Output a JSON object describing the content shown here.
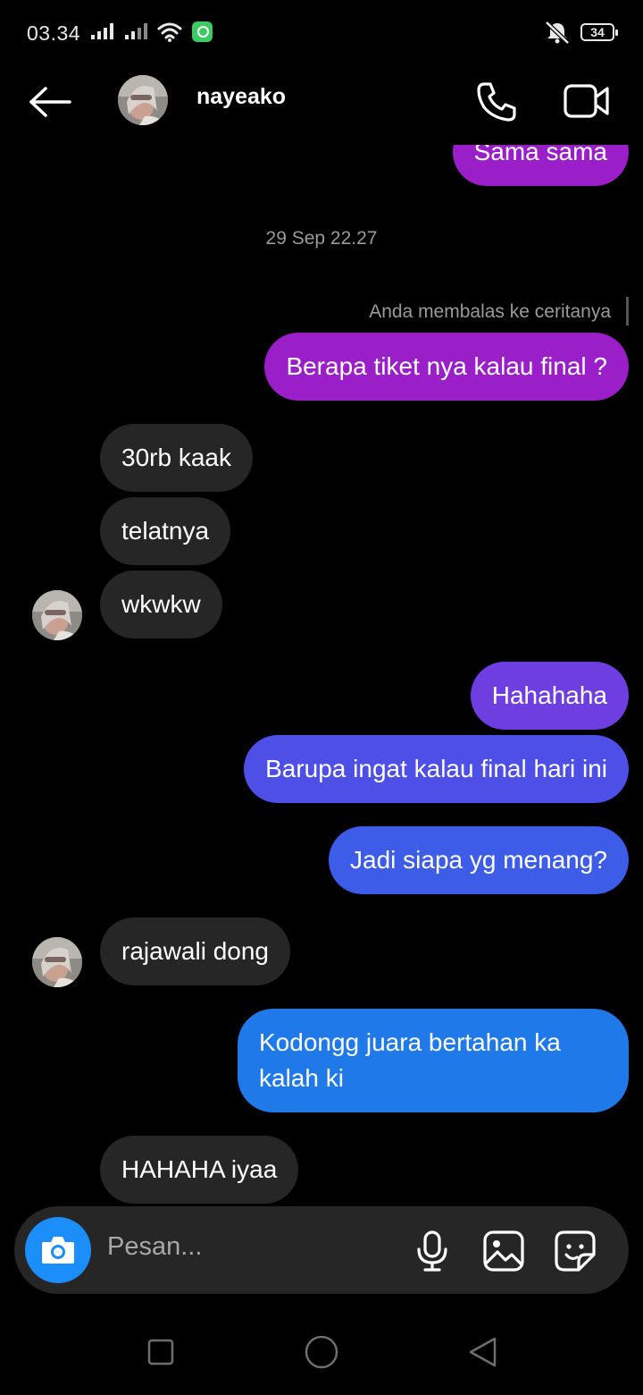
{
  "status_bar": {
    "time": "03.34",
    "battery": "34"
  },
  "header": {
    "username": "nayeako"
  },
  "conversation": {
    "partial_message": "Sama sama",
    "timestamp": "29 Sep 22.27",
    "story_reply_note": "Anda membalas ke ceritanya",
    "messages": [
      {
        "from": "me",
        "text": "Berapa tiket nya kalau final ?"
      },
      {
        "from": "them",
        "text": "30rb kaak"
      },
      {
        "from": "them",
        "text": "telatnya"
      },
      {
        "from": "them",
        "text": "wkwkw"
      },
      {
        "from": "me",
        "text": "Hahahaha"
      },
      {
        "from": "me",
        "text": "Barupa ingat kalau final hari ini"
      },
      {
        "from": "me",
        "text": "Jadi siapa yg menang?"
      },
      {
        "from": "them",
        "text": "rajawali dong"
      },
      {
        "from": "me",
        "text": "Kodongg juara bertahan ka kalah ki"
      },
      {
        "from": "them",
        "text": "HAHAHA iyaa"
      }
    ]
  },
  "composer": {
    "placeholder": "Pesan..."
  },
  "colors": {
    "background": "#000000",
    "received_bubble": "#262626",
    "sent_purple": "#9a1fc8",
    "sent_blue": "#2079e8",
    "camera_button": "#1c8ef9"
  }
}
